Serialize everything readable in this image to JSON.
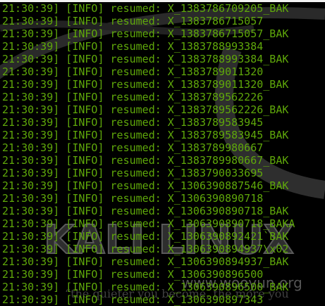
{
  "watermark": {
    "logo": "KALI LINUX",
    "site": "www.wooyun.org",
    "motto": "“the quieter you become, the more you"
  },
  "log_lines": [
    "21:30:39] [INFO] resumed: X_1383786709205_BAK",
    "21:30:39] [INFO] resumed: X_1383786715057",
    "21:30:39] [INFO] resumed: X_1383786715057_BAK",
    "21:30:39] [INFO] resumed: X_1383788993384",
    "21:30:39] [INFO] resumed: X_1383788993384_BAK",
    "21:30:39] [INFO] resumed: X_1383789011320",
    "21:30:39] [INFO] resumed: X_1383789011320_BAK",
    "21:30:39] [INFO] resumed: X_1383789562226",
    "21:30:39] [INFO] resumed: X_1383789562226_BAK",
    "21:30:39] [INFO] resumed: X_1383789583945",
    "21:30:39] [INFO] resumed: X_1383789583945_BAK",
    "21:30:39] [INFO] resumed: X_1383789980667",
    "21:30:39] [INFO] resumed: X_1383789980667_BAK",
    "21:30:39] [INFO] resumed: X_1383790033695",
    "21:30:39] [INFO] resumed: X_1306390887546_BAK",
    "21:30:39] [INFO] resumed: X_1306390890718",
    "21:30:39] [INFO] resumed: X_1306390890718_BAK",
    "21:30:39] [INFO] resumed: X_1306390890718_BAKA",
    "21:30:39] [INFO] resumed: X_1306390892421`BAK",
    "21:30:39] [INFO] resumed: X_1306390894937\\x02",
    "21:30:39] [INFO] resumed: X_1306390894937_BAK",
    "21:30:39] [INFO] resumed: X_1306390896500",
    "21:30:39] [INFO] resumed: X_1306390896500_BAK",
    "21:30:39] [INFO] resumed: X_1306390897343"
  ]
}
